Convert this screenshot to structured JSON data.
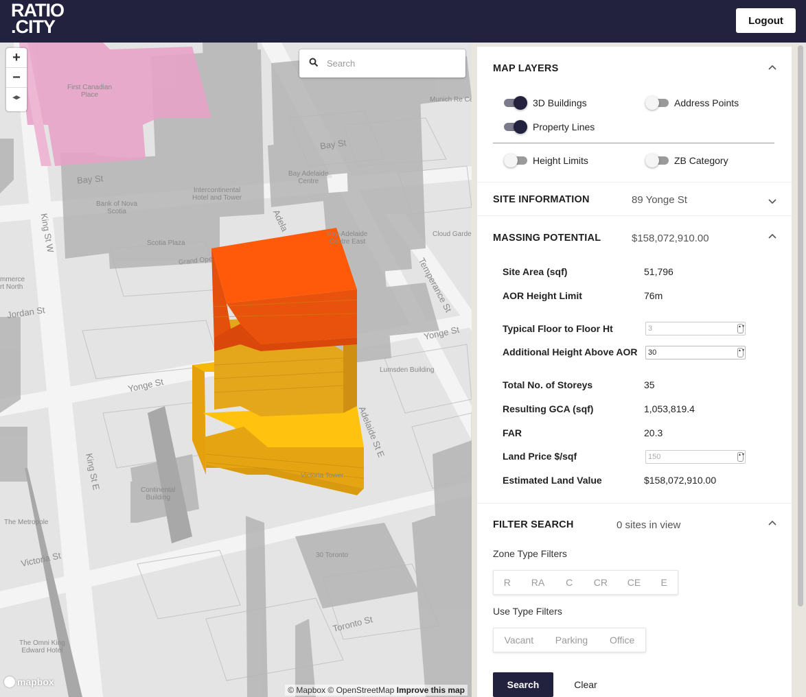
{
  "header": {
    "logo_line1": "RATIO",
    "logo_line2": ".CITY",
    "logout_label": "Logout"
  },
  "map": {
    "search_placeholder": "Search",
    "zoom_in": "+",
    "zoom_out": "−",
    "compass": "◂▸",
    "mapbox_logo": "mapbox",
    "attribution_prefix": "© Mapbox © OpenStreetMap",
    "attribution_link": "Improve this map",
    "streets": {
      "bay_st": "Bay St",
      "bay_st_left": "Bay St",
      "king_st_w": "King St W",
      "king_st_e": "King St E",
      "adelaide": "Adelaide St E",
      "adelaide_top": "Adela",
      "temperance": "Temperance St",
      "yonge_st_right": "Yonge St",
      "yonge_st_left": "Yonge St",
      "jordan_st": "Jordan St",
      "victoria_st": "Victoria St",
      "toronto_st": "Toronto St",
      "grand_opera": "Grand Ope"
    },
    "pois": {
      "first_canadian": "First Canadian\nPlace",
      "munich_re": "Munich Re Ce",
      "bay_adelaide": "Bay Adelaide\nCentre",
      "intercontinental": "Intercontinental\nHotel and Tower",
      "bank_nova": "Bank of Nova\nScotia",
      "scotia_plaza": "Scotia Plaza",
      "bay_adelaide_east": "Bay-Adelaide\nCentre East",
      "cloud_garden": "Cloud Garde",
      "commerce_north": "mmerce\nrt North",
      "lumsden": "Lumsden Building",
      "victoria_tower": "Victoria Tower",
      "continental": "Continental\nBuilding",
      "the_metropole": "The Metropole",
      "toronto_30": "30 Toronto",
      "omni_king": "The Omni King\nEdward Hotel"
    }
  },
  "panel": {
    "map_layers": {
      "title": "MAP LAYERS",
      "toggles": [
        {
          "label": "3D Buildings",
          "on": true
        },
        {
          "label": "Address Points",
          "on": false
        },
        {
          "label": "Property Lines",
          "on": true
        },
        {
          "label": "Height Limits",
          "on": false
        },
        {
          "label": "ZB Category",
          "on": false
        }
      ]
    },
    "site_info": {
      "title": "SITE INFORMATION",
      "value": "89 Yonge St"
    },
    "massing": {
      "title": "MASSING POTENTIAL",
      "value": "$158,072,910.00",
      "site_area_label": "Site Area (sqf)",
      "site_area": "51,796",
      "aor_label": "AOR Height Limit",
      "aor": "76m",
      "floor_ht_label": "Typical Floor to Floor Ht",
      "floor_ht": "3",
      "add_height_label": "Additional Height Above AOR",
      "add_height": "30",
      "storeys_label": "Total No. of Storeys",
      "storeys": "35",
      "gca_label": "Resulting GCA (sqf)",
      "gca": "1,053,819.4",
      "far_label": "FAR",
      "far": "20.3",
      "land_price_label": "Land Price $/sqf",
      "land_price": "150",
      "land_value_label": "Estimated Land Value",
      "land_value": "$158,072,910.00"
    },
    "filter": {
      "title": "FILTER SEARCH",
      "value": "0 sites in view",
      "zone_label": "Zone Type Filters",
      "zones": [
        "R",
        "RA",
        "C",
        "CR",
        "CE",
        "E"
      ],
      "use_label": "Use Type Filters",
      "uses": [
        "Vacant",
        "Parking",
        "Office"
      ],
      "search_label": "Search",
      "clear_label": "Clear"
    }
  },
  "colors": {
    "header_bg": "#22223f",
    "massing_top": "#ff5a0a",
    "massing_mid": "#e4a61a",
    "massing_base": "#ffc20e",
    "highlight_pink": "#e7a3c8"
  }
}
